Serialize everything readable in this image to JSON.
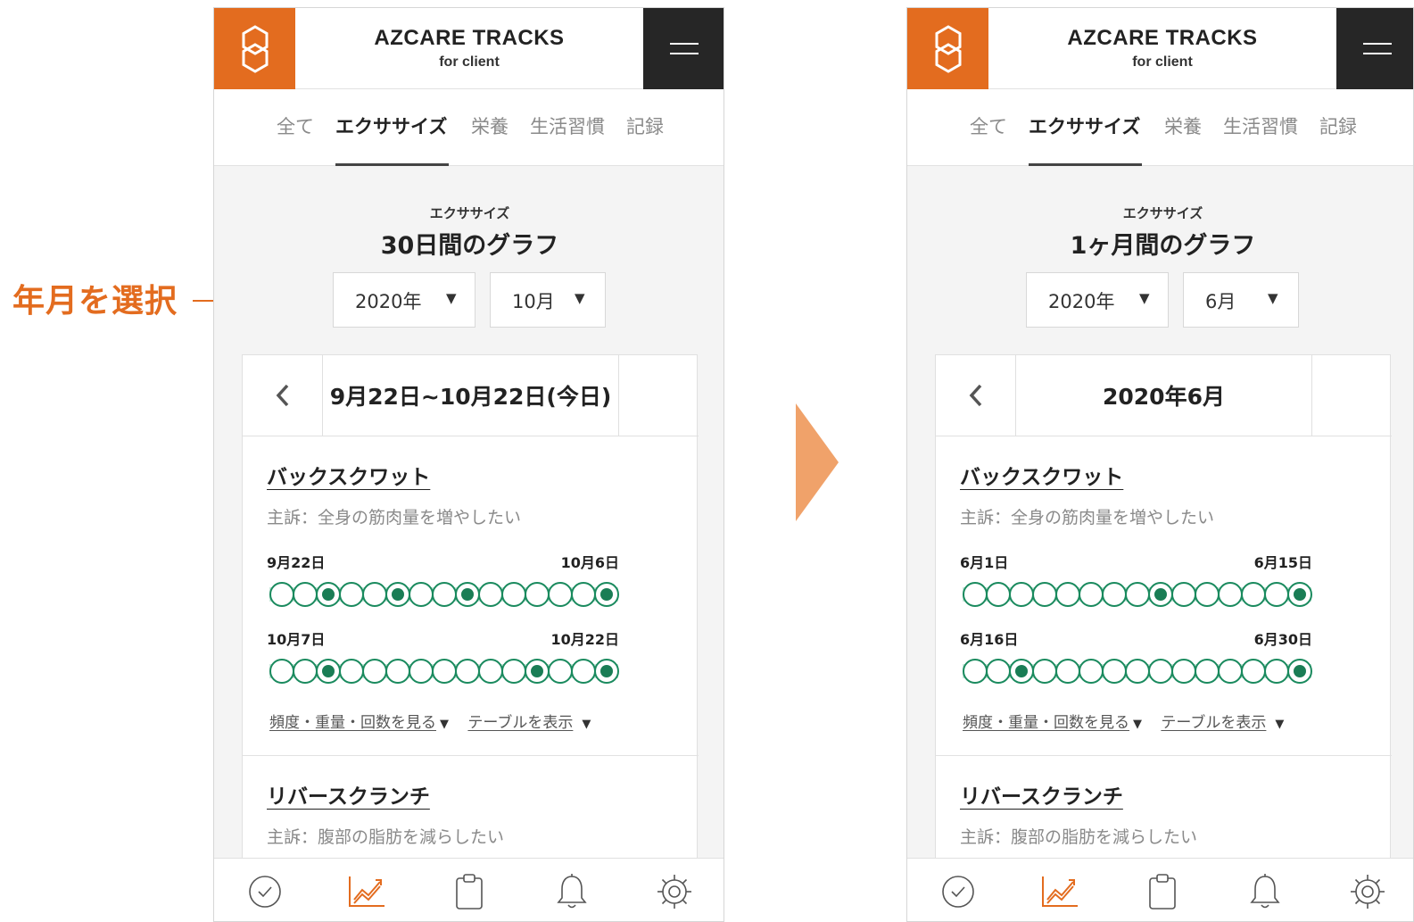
{
  "callout": {
    "label": "年月を選択",
    "accent": "#e36c1f"
  },
  "colors": {
    "brand_orange": "#e36c1f",
    "menu_dark": "#262626",
    "track_green": "#1a8a5e",
    "track_fill": "#c9e9dc",
    "arrow": "#f0a26a"
  },
  "screens": [
    {
      "header": {
        "title": "AZCARE TRACKS",
        "subtitle": "for client",
        "logo_icon": "hexagon-logo-icon",
        "menu_icon": "hamburger-menu-icon"
      },
      "tabs": [
        "全て",
        "エクササイズ",
        "栄養",
        "生活習慣",
        "記録"
      ],
      "active_tab": "エクササイズ",
      "section_label": "エクササイズ",
      "section_title": "30日間のグラフ",
      "year_select": "2020年",
      "month_select": "10月",
      "caret": "▼",
      "range_label": "9月22日~10月22日(今日)",
      "exercises": [
        {
          "name": "バックスクワット",
          "note": "主訴：全身の筋肉量を増やしたい",
          "rows": [
            {
              "start": "9月22日",
              "end": "10月6日",
              "dots": [
                0,
                0,
                1,
                0,
                0,
                1,
                0,
                0,
                1,
                0,
                0,
                0,
                0,
                0,
                1
              ]
            },
            {
              "start": "10月7日",
              "end": "10月22日",
              "dots": [
                0,
                0,
                1,
                0,
                0,
                0,
                0,
                0,
                0,
                0,
                0,
                1,
                0,
                0,
                1
              ]
            }
          ],
          "link_detail": "頻度・重量・回数を見る",
          "link_table": "テーブルを表示"
        },
        {
          "name": "リバースクランチ",
          "note": "主訴：腹部の脂肪を減らしたい"
        }
      ]
    },
    {
      "header": {
        "title": "AZCARE TRACKS",
        "subtitle": "for client",
        "logo_icon": "hexagon-logo-icon",
        "menu_icon": "hamburger-menu-icon"
      },
      "tabs": [
        "全て",
        "エクササイズ",
        "栄養",
        "生活習慣",
        "記録"
      ],
      "active_tab": "エクササイズ",
      "section_label": "エクササイズ",
      "section_title": "1ヶ月間のグラフ",
      "year_select": "2020年",
      "month_select": "6月",
      "caret": "▼",
      "range_label": "2020年6月",
      "exercises": [
        {
          "name": "バックスクワット",
          "note": "主訴：全身の筋肉量を増やしたい",
          "rows": [
            {
              "start": "6月1日",
              "end": "6月15日",
              "dots": [
                0,
                0,
                0,
                0,
                0,
                0,
                0,
                0,
                1,
                0,
                0,
                0,
                0,
                0,
                1
              ]
            },
            {
              "start": "6月16日",
              "end": "6月30日",
              "dots": [
                0,
                0,
                1,
                0,
                0,
                0,
                0,
                0,
                0,
                0,
                0,
                0,
                0,
                0,
                1
              ]
            }
          ],
          "link_detail": "頻度・重量・回数を見る",
          "link_table": "テーブルを表示"
        },
        {
          "name": "リバースクランチ",
          "note": "主訴：腹部の脂肪を減らしたい"
        }
      ]
    }
  ],
  "bottom_nav_icons": [
    "check-circle-icon",
    "chart-icon",
    "clipboard-icon",
    "bell-icon",
    "gear-icon"
  ]
}
